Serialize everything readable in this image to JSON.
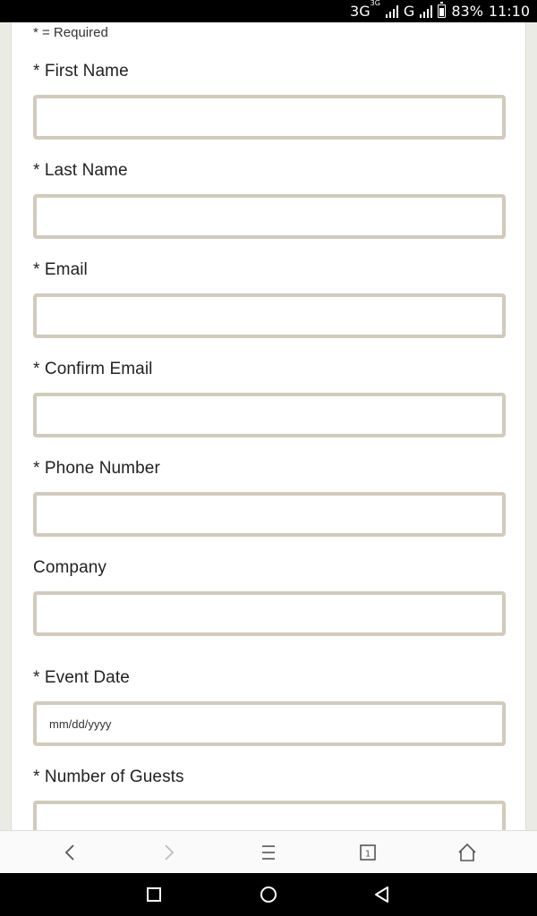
{
  "status_bar": {
    "network_primary": "3G",
    "network_superscript": "3G",
    "network_secondary": "G",
    "battery_percent": "83%",
    "time": "11:10"
  },
  "form": {
    "required_note": "* = Required",
    "fields": [
      {
        "label": "* First Name",
        "value": "",
        "placeholder": ""
      },
      {
        "label": "* Last Name",
        "value": "",
        "placeholder": ""
      },
      {
        "label": "* Email",
        "value": "",
        "placeholder": ""
      },
      {
        "label": "* Confirm Email",
        "value": "",
        "placeholder": ""
      },
      {
        "label": "* Phone Number",
        "value": "",
        "placeholder": ""
      },
      {
        "label": "Company",
        "value": "",
        "placeholder": ""
      },
      {
        "label": "* Event Date",
        "value": "",
        "placeholder": "mm/dd/yyyy"
      },
      {
        "label": "* Number of Guests",
        "value": "",
        "placeholder": ""
      }
    ]
  },
  "browser_nav": {
    "tab_count": "1",
    "icons": [
      "back-icon",
      "forward-icon",
      "menu-icon",
      "tabs-icon",
      "home-icon"
    ]
  },
  "system_nav": {
    "icons": [
      "recents-icon",
      "home-circle-icon",
      "back-triangle-icon"
    ]
  },
  "colors": {
    "input_border": "#d2cabb",
    "page_background": "#ebebe6",
    "forward_disabled": "#bdbdbd"
  }
}
